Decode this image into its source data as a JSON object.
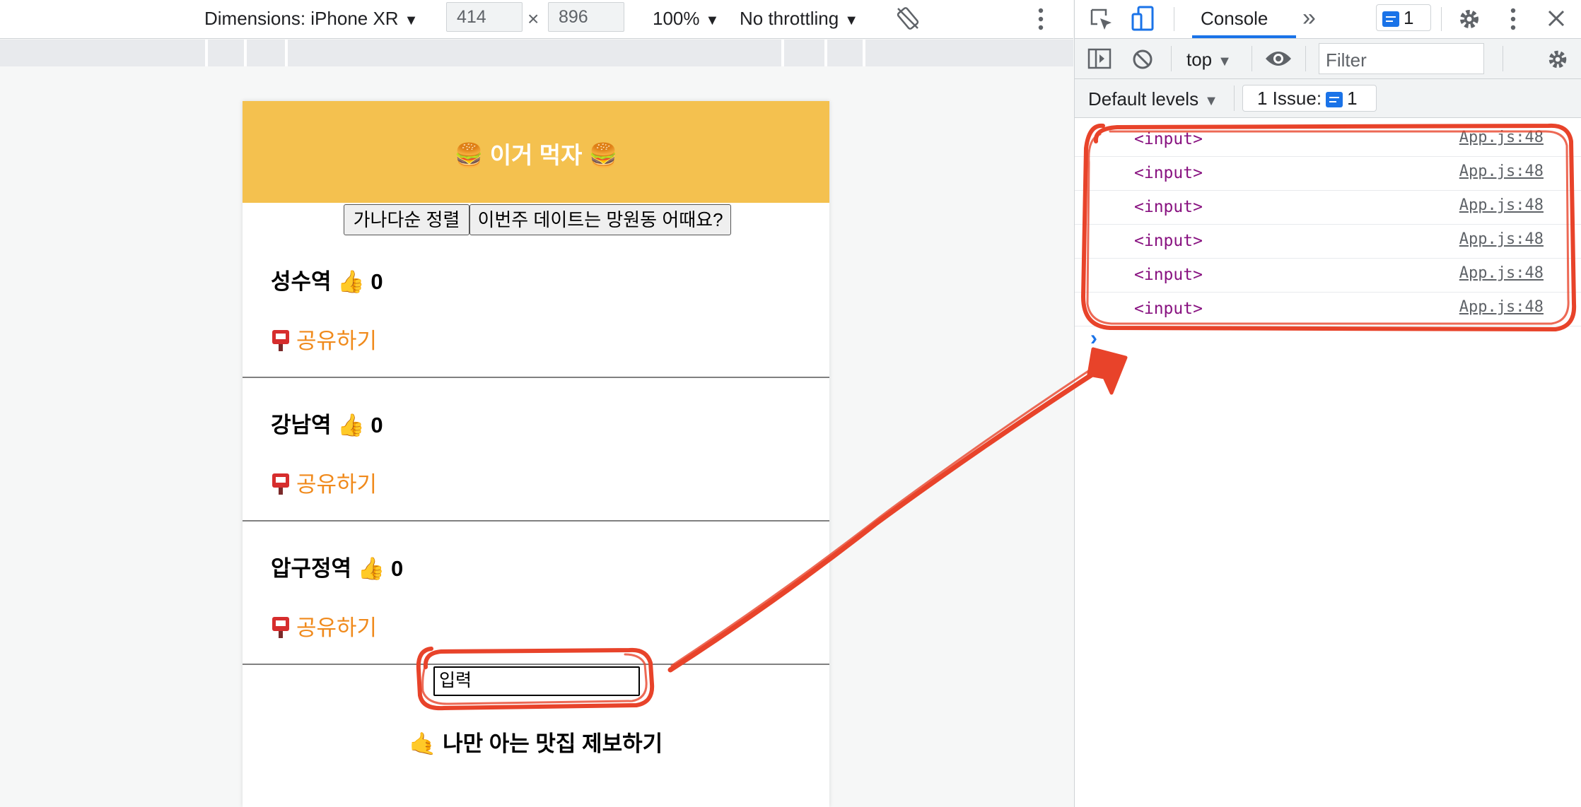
{
  "device_toolbar": {
    "dimensions_label": "Dimensions: iPhone XR",
    "width_value": "414",
    "times_sign": "×",
    "height_value": "896",
    "zoom": "100%",
    "throttling": "No throttling",
    "rotate_icon": "rotate-icon",
    "more_icon": "vertical-dots-icon"
  },
  "app": {
    "header_title": "🍔 이거 먹자 🍔",
    "header_color": "#f4c14f",
    "sort_button": "가나다순 정렬",
    "date_button": "이번주 데이트는 망원동 어때요?",
    "items": [
      {
        "name": "성수역",
        "likes": "0",
        "share": "공유하기"
      },
      {
        "name": "강남역",
        "likes": "0",
        "share": "공유하기"
      },
      {
        "name": "압구정역",
        "likes": "0",
        "share": "공유하기"
      }
    ],
    "like_emoji": "👍",
    "share_color": "#f08a1c",
    "input_value": "입력",
    "tip_label": "🤙 나만 아는 맛집 제보하기"
  },
  "devtools": {
    "active_tab": "Console",
    "more_tabs_icon": "chevron-double-right-icon",
    "issues_badge_count": "1",
    "context_select": "top",
    "filter_placeholder": "Filter",
    "levels_select": "Default levels",
    "issues_label": "1 Issue:",
    "issues_count": "1",
    "accent_color": "#1a73e8",
    "console_logs": [
      {
        "message": "<input>",
        "source": "App.js:48"
      },
      {
        "message": "<input>",
        "source": "App.js:48"
      },
      {
        "message": "<input>",
        "source": "App.js:48"
      },
      {
        "message": "<input>",
        "source": "App.js:48"
      },
      {
        "message": "<input>",
        "source": "App.js:48"
      },
      {
        "message": "<input>",
        "source": "App.js:48"
      }
    ],
    "prompt_symbol": "›"
  },
  "annotation": {
    "color": "#e8432a"
  }
}
